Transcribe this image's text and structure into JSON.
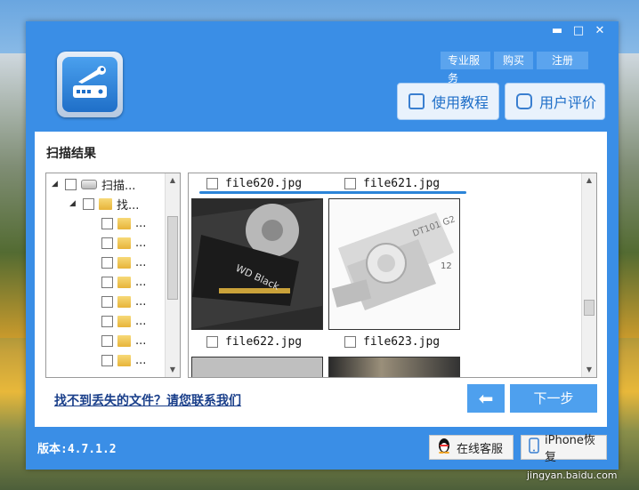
{
  "window_controls": {
    "minimize": "▬",
    "maximize": "□",
    "close": "✕"
  },
  "top_links": {
    "service": "专业服务",
    "buy": "购买",
    "register": "注册"
  },
  "header_buttons": {
    "tutorial": "使用教程",
    "review": "用户评价"
  },
  "panel": {
    "title": "扫描结果"
  },
  "tree": {
    "root": {
      "label": "扫描..."
    },
    "child": {
      "label": "找..."
    },
    "items": [
      "...",
      "...",
      "...",
      "...",
      "...",
      "...",
      "...",
      "..."
    ]
  },
  "files": [
    {
      "name": "file620.jpg"
    },
    {
      "name": "file621.jpg"
    },
    {
      "name": "file622.jpg"
    },
    {
      "name": "file623.jpg"
    }
  ],
  "thumb_text": {
    "wd": "WD Black",
    "usb": "DT101 G2",
    "usb_cap": "12"
  },
  "footer": {
    "help_link": "找不到丢失的文件？请您联系我们",
    "back_icon": "⬅",
    "next_label": "下一步",
    "version": "版本:4.7.1.2",
    "online_service": "在线客服",
    "iphone_recovery": "iPhone恢复"
  },
  "watermark": "jingyan.baidu.com",
  "colors": {
    "accent": "#3a8ee6",
    "button": "#4ea0ee",
    "link": "#1a3f8a"
  },
  "icons": {
    "logo": "drive-wrench-icon",
    "tutorial": "document-icon",
    "review": "chat-icon",
    "back": "back-arrow-icon",
    "online_service": "qq-penguin-icon",
    "iphone_recovery": "phone-icon"
  }
}
